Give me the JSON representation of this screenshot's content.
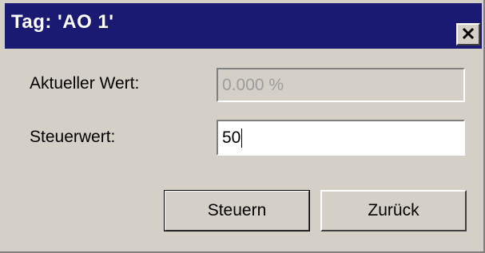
{
  "window": {
    "title": "Tag: 'AO 1'",
    "close_glyph": "✕",
    "close_icon": "close-icon"
  },
  "form": {
    "current_value_label": "Aktueller Wert:",
    "current_value": "0.000 %",
    "control_value_label": "Steuerwert:",
    "control_value": "50"
  },
  "buttons": {
    "apply_label": "Steuern",
    "back_label": "Zurück"
  },
  "colors": {
    "titlebar": "#1a1a73",
    "face": "#d4d0c8"
  }
}
